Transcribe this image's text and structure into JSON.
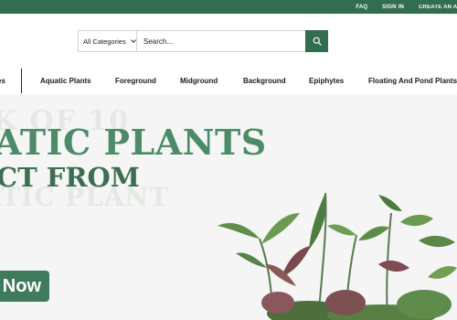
{
  "topbar": {
    "links": [
      "FAQ",
      "SIGN IN",
      "CREATE AN ACC"
    ]
  },
  "search": {
    "category": "All Categories",
    "placeholder": "Search..."
  },
  "nav": {
    "items": [
      "es",
      "Aquatic Plants",
      "Foreground",
      "Midground",
      "Background",
      "Epiphytes",
      "Floating And Pond Plants"
    ]
  },
  "hero": {
    "ghost_line_1": "K OF 10",
    "headline_1": "ATIC PLANTS",
    "headline_2": "CT FROM",
    "ghost_line_2": "ATIC PLANT",
    "button_label": "Now",
    "image_icon": "aquatic-plants-image"
  },
  "colors": {
    "brand_green": "#336d4f",
    "headline_green": "#4d8a68",
    "headline_dark_green": "#3e6d52",
    "button_green": "#3f7a5d",
    "hero_bg": "#f4f5f4"
  }
}
